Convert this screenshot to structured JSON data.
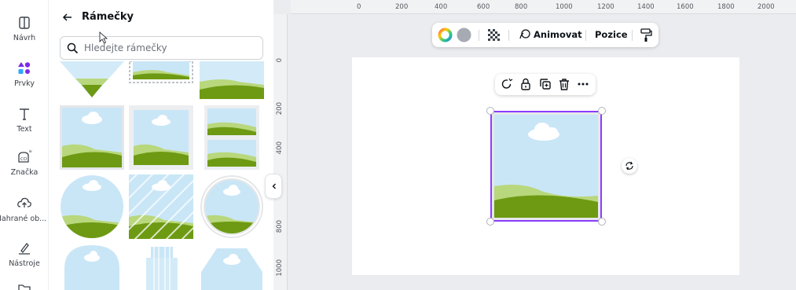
{
  "sidebar": {
    "items": [
      {
        "label": "Návrh",
        "icon": "layout-icon"
      },
      {
        "label": "Prvky",
        "icon": "elements-icon"
      },
      {
        "label": "Text",
        "icon": "text-icon"
      },
      {
        "label": "Značka",
        "icon": "brand-icon"
      },
      {
        "label": "Nahrané ob...",
        "icon": "upload-icon"
      },
      {
        "label": "Nástroje",
        "icon": "draw-icon"
      }
    ]
  },
  "panel": {
    "title": "Rámečky",
    "search_placeholder": "Hledejte rámečky"
  },
  "ruler": {
    "top": [
      "0",
      "200",
      "400",
      "600",
      "800",
      "1000",
      "1200",
      "1400",
      "1600",
      "1800",
      "2000"
    ],
    "left": [
      "0",
      "200",
      "400",
      "600",
      "800",
      "1000"
    ]
  },
  "toolbar": {
    "animate_label": "Animovat",
    "position_label": "Pozice"
  },
  "colors": {
    "selection": "#8b3dff",
    "sky": "#c9e6f7",
    "hill_light": "#b9d77c",
    "hill_dark": "#6d9a12"
  }
}
